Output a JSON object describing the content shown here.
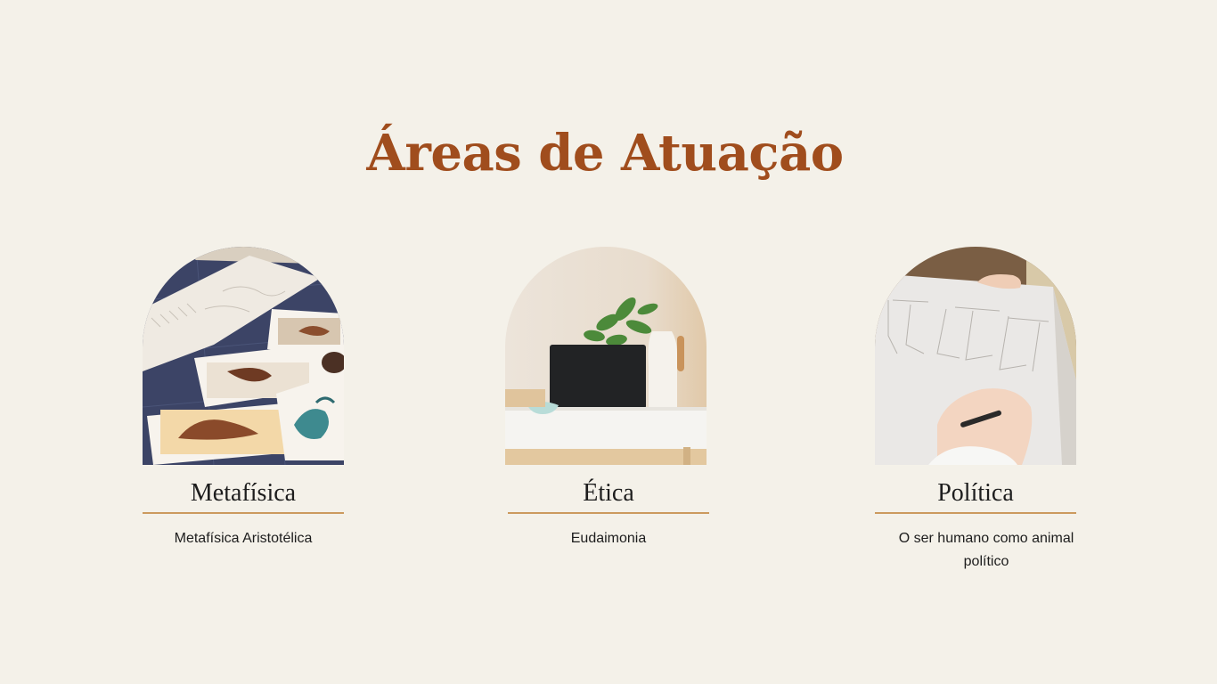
{
  "slide": {
    "title": "Áreas de Atuação"
  },
  "cards": [
    {
      "title": "Metafísica",
      "description": "Metafísica Aristotélica",
      "image_icon": "fashion-sketches-photo"
    },
    {
      "title": "Ética",
      "description": "Eudaimonia",
      "image_icon": "laptop-desk-photo"
    },
    {
      "title": "Política",
      "description": "O ser humano como animal político",
      "image_icon": "drawing-sketch-photo"
    }
  ],
  "colors": {
    "background": "#f4f1e9",
    "title": "#a04d1d",
    "rule": "#cc9a5e",
    "text": "#1d1d1d"
  }
}
